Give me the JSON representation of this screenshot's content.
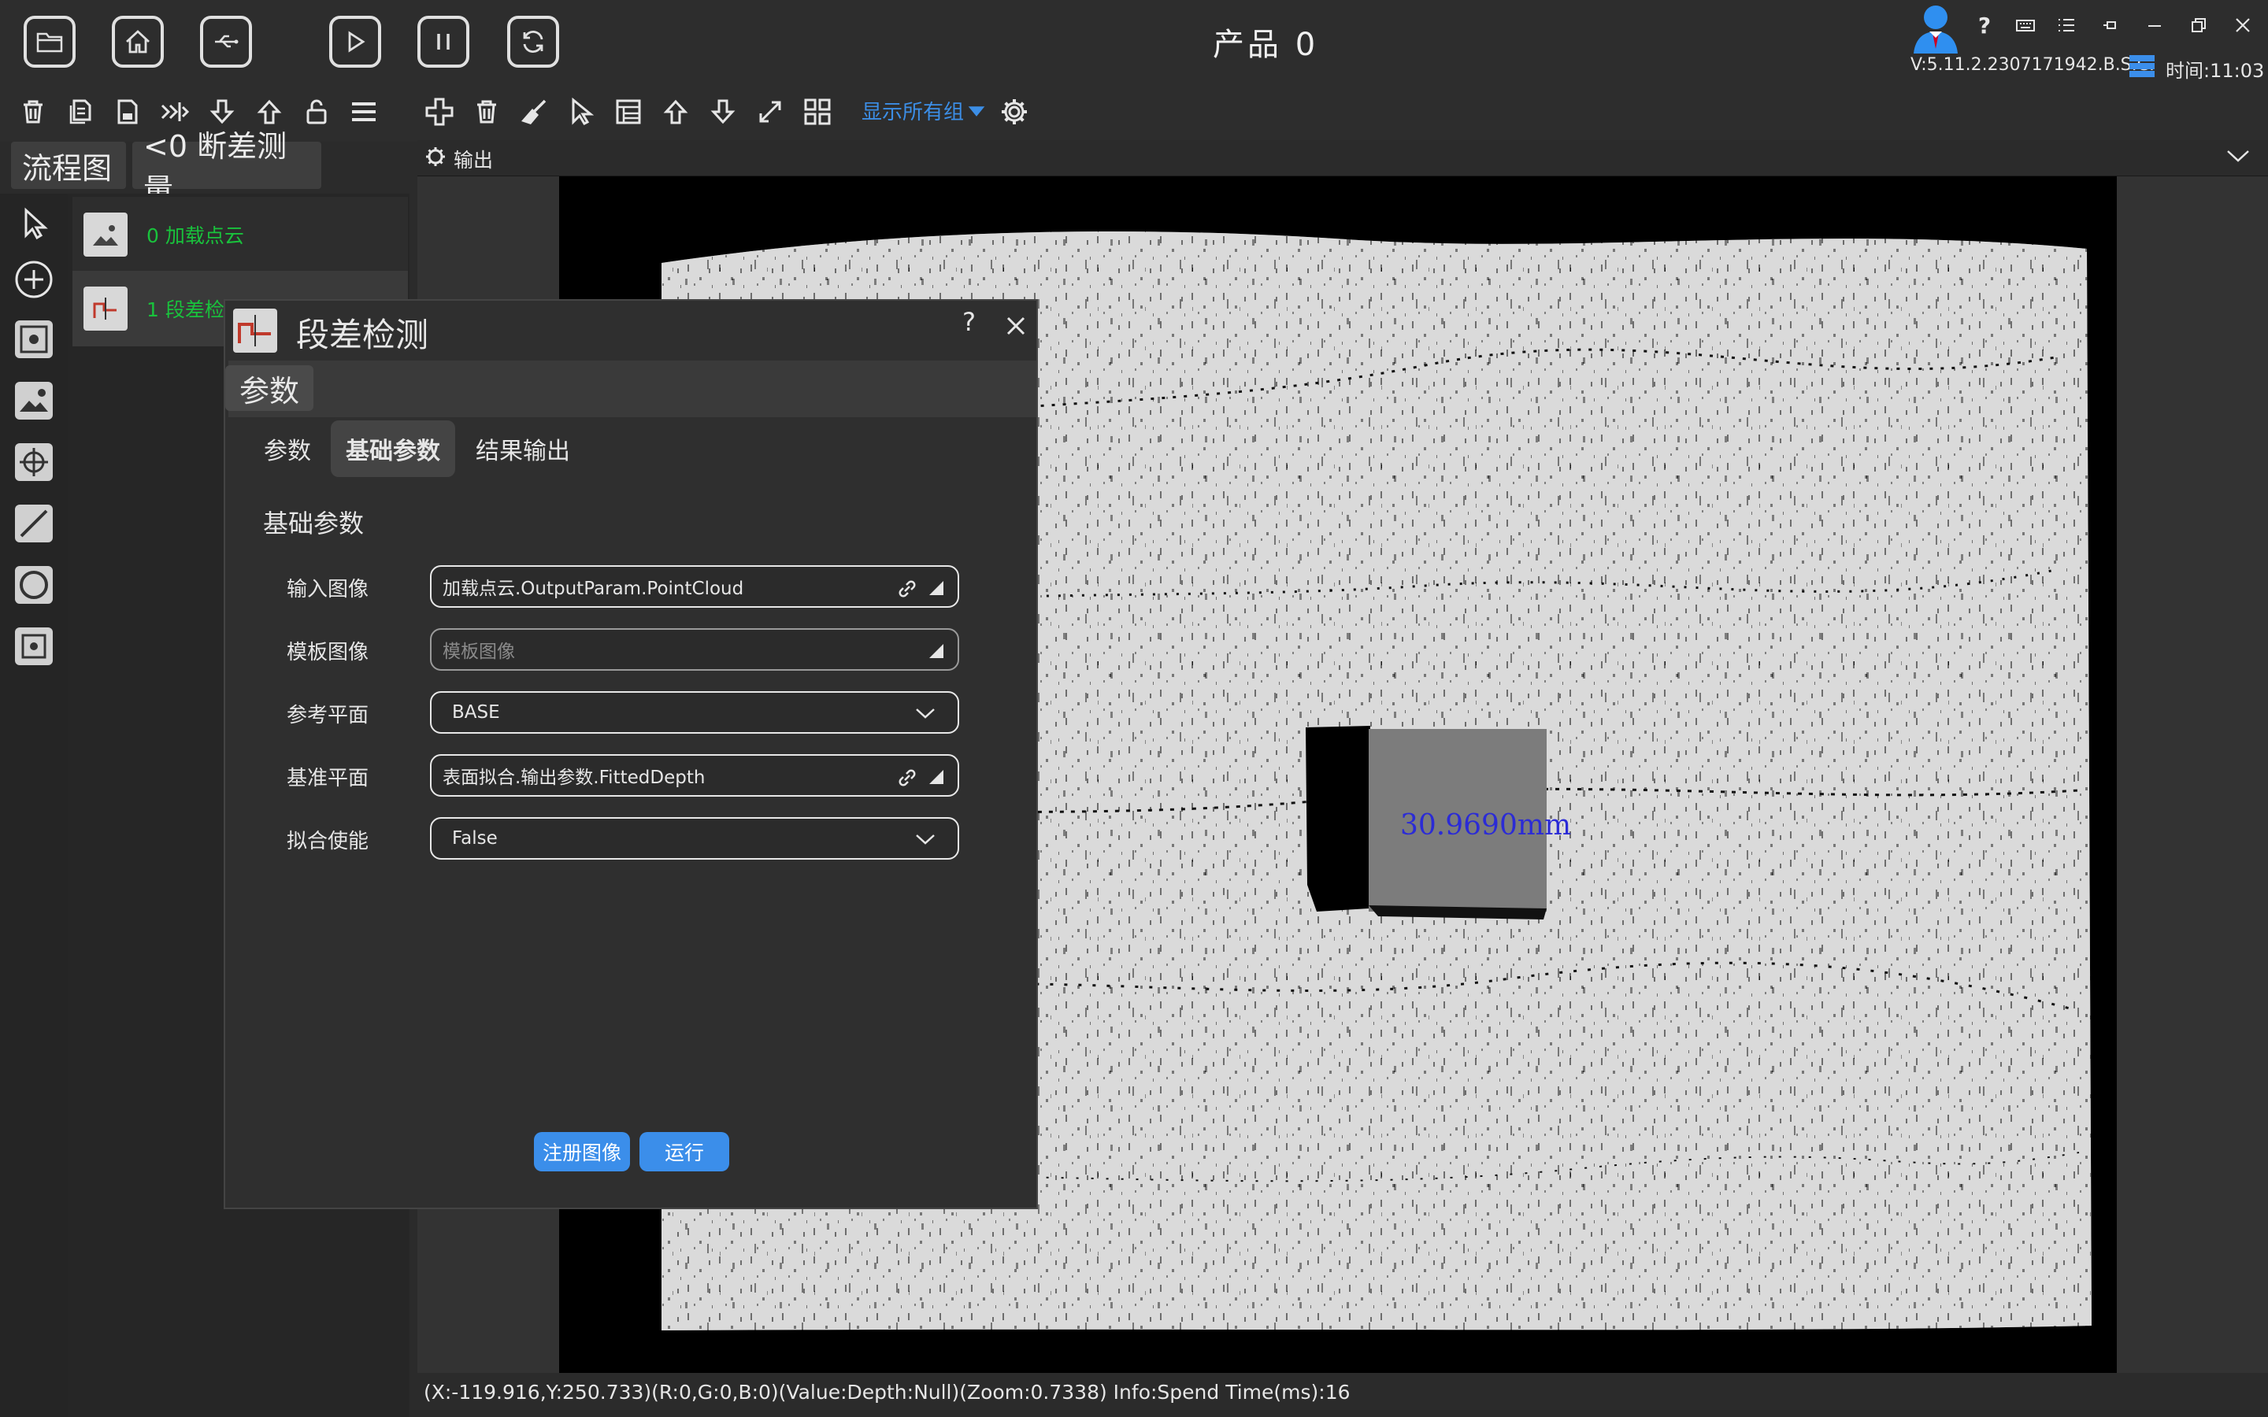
{
  "header": {
    "product_title": "产品 0",
    "version": "V:5.11.2.2307171942.B.S.C.",
    "time": "时间:11:03",
    "top_icons": [
      "folder-open-icon",
      "home-icon",
      "usb-icon",
      "play-icon",
      "pause-icon",
      "refresh-icon"
    ],
    "window_icons": [
      "user-avatar-icon",
      "help-icon",
      "keyboard-icon",
      "list-icon",
      "pin-icon",
      "minimize-icon",
      "restore-icon",
      "close-icon"
    ]
  },
  "toolbar": {
    "left_icons": [
      "delete-icon",
      "copy-icon",
      "save-icon",
      "split-icon",
      "arrow-down-icon",
      "arrow-up-icon",
      "lock-icon",
      "menu-icon"
    ],
    "right_icons": [
      "add-icon",
      "trash-icon",
      "broom-icon",
      "cursor-icon",
      "sheet-icon",
      "move-up-icon",
      "move-down-icon",
      "expand-icon",
      "grid-icon"
    ],
    "group_select": "显示所有组",
    "settings_icon": "gear-icon"
  },
  "tabs": {
    "flowchart": "流程图",
    "measure": "<0 断差测量"
  },
  "tools": [
    "pointer-icon",
    "add-circle-icon",
    "image-frame-icon",
    "image-icon",
    "target-icon",
    "line-icon",
    "circle-icon",
    "target-frame-icon"
  ],
  "nodes": [
    {
      "label": "0  加载点云"
    },
    {
      "label": "1  段差检"
    }
  ],
  "output": {
    "title": "输出",
    "measurement": "30.9690mm"
  },
  "status": "(X:-119.916,Y:250.733)(R:0,G:0,B:0)(Value:Depth:Null)(Zoom:0.7338)   Info:Spend Time(ms):16",
  "dialog": {
    "title": "段差检测",
    "help": "?",
    "section": "参数",
    "tabs": [
      "参数",
      "基础参数",
      "结果输出"
    ],
    "active_tab": "基础参数",
    "group_title": "基础参数",
    "params": [
      {
        "label": "输入图像",
        "value": "加载点云.OutputParam.PointCloud",
        "kind": "link"
      },
      {
        "label": "模板图像",
        "placeholder": "模板图像",
        "kind": "input"
      },
      {
        "label": "参考平面",
        "value": "BASE",
        "kind": "select"
      },
      {
        "label": "基准平面",
        "value": "表面拟合.输出参数.FittedDepth",
        "kind": "link"
      },
      {
        "label": "拟合使能",
        "value": "False",
        "kind": "select"
      }
    ],
    "buttons": {
      "register": "注册图像",
      "run": "运行"
    }
  },
  "colors": {
    "accent": "#3b8eea",
    "node_text": "#19c23c",
    "measure_text": "#2b2bd6"
  }
}
